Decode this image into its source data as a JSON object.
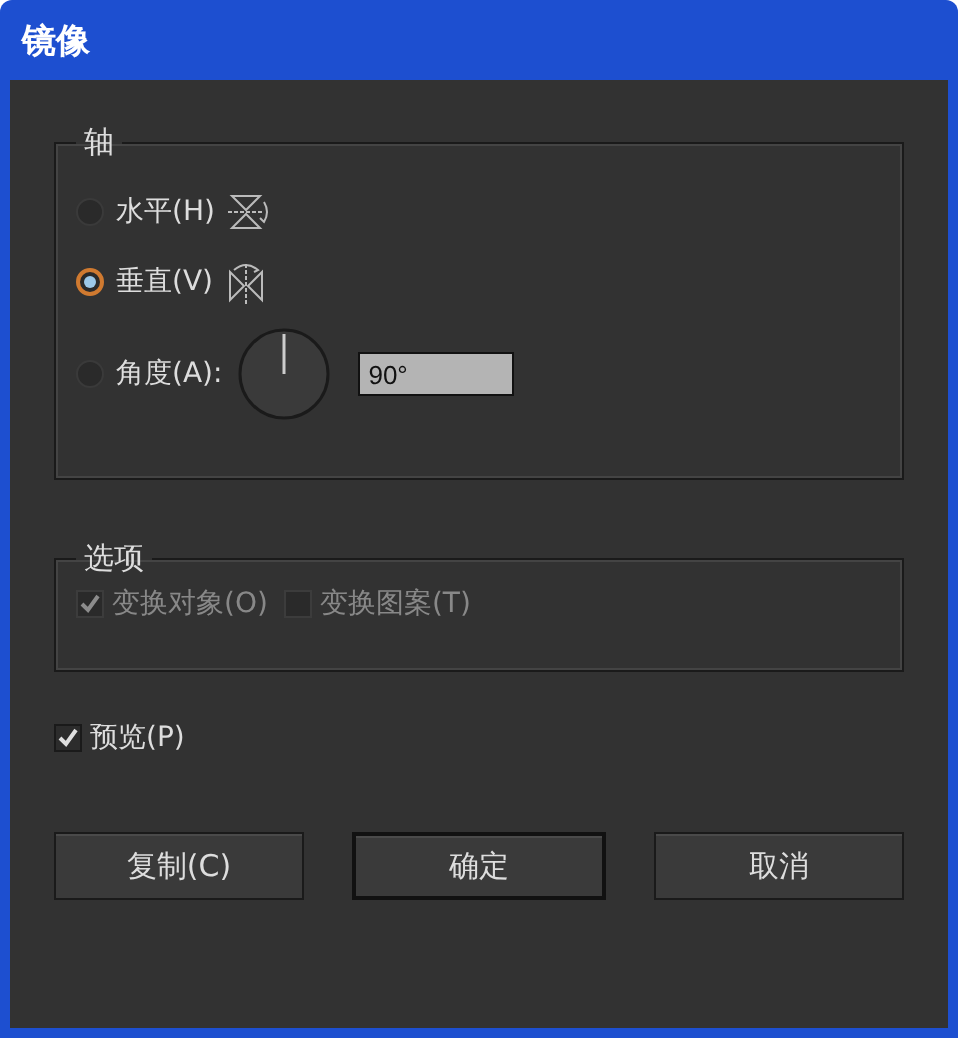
{
  "window": {
    "title": "镜像"
  },
  "axis": {
    "title": "轴",
    "options": [
      {
        "kind": "horizontal",
        "label": "水平(H)",
        "selected": false
      },
      {
        "kind": "vertical",
        "label": "垂直(V)",
        "selected": true
      },
      {
        "kind": "angle",
        "label": "角度(A):",
        "selected": false,
        "value": "90°"
      }
    ]
  },
  "options": {
    "title": "选项",
    "checkboxes": [
      {
        "label": "变换对象(O)",
        "checked": true,
        "disabled": true
      },
      {
        "label": "变换图案(T)",
        "checked": false,
        "disabled": true
      }
    ]
  },
  "preview": {
    "label": "预览(P)",
    "checked": true
  },
  "buttons": [
    {
      "label": "复制(C)",
      "default": false
    },
    {
      "label": "确定",
      "default": true
    },
    {
      "label": "取消",
      "default": false
    }
  ]
}
